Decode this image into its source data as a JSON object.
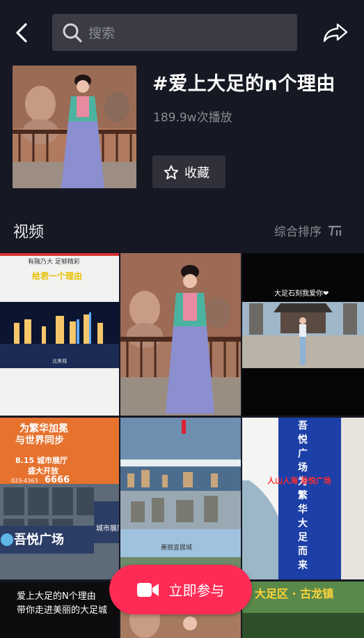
{
  "search": {
    "placeholder": "搜索"
  },
  "topic": {
    "title": "#爱上大足的n个理由",
    "plays": "189.9w次播放",
    "favorite_label": "收藏"
  },
  "videos_section": {
    "title": "视频",
    "sort_label": "综合排序"
  },
  "videos": [
    {
      "caption_top": "有融乃大 足够精彩",
      "caption_main": "给君一个理由",
      "caption_small": "北美城"
    },
    {},
    {
      "caption_top": "大足石刻我爱你❤"
    },
    {
      "billboard_lines": [
        "为繁华加冕",
        "与世界同步"
      ],
      "billboard_event": "8.15 城市展厅",
      "billboard_open": "盛大开放",
      "billboard_phone": "6666",
      "billboard_phone_prefix": "023-4363",
      "building_sign": "吾悦广场",
      "building_sign2": "城市展厅"
    },
    {
      "caption_mid": "美丽宜居城"
    },
    {
      "banner_text": "吾悦广场 为繁华大足而来",
      "overlay_text": "人山人海 吾悦广场"
    },
    {
      "caption_bottom1": "爱上大足的N个理由",
      "caption_bottom2": "带你走进美丽的大足城"
    },
    {},
    {
      "caption_top": "大足区 · 古龙镇"
    }
  ],
  "join_button": {
    "label": "立即参与"
  },
  "colors": {
    "background": "#161823",
    "accent": "#fe2c55",
    "search_bg": "#3a3b44",
    "secondary_text": "#8b8c93"
  }
}
